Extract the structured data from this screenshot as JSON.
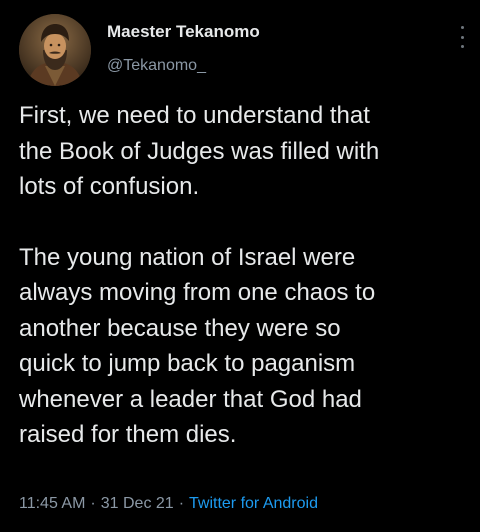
{
  "tweet": {
    "author": {
      "display_name": "Maester Tekanomo",
      "handle": "@Tekanomo_",
      "avatar_icon": "portrait-painting-avatar"
    },
    "paragraphs": [
      "First, we need to understand that\nthe Book of Judges was filled with\nlots of confusion.",
      "The young nation of Israel were\nalways moving from one chaos to\nanother because they were so\nquick to jump back to paganism\nwhenever a leader that God had\nraised for them dies."
    ],
    "time": "11:45 AM",
    "separator": "·",
    "date": "31 Dec 21",
    "source": "Twitter for Android"
  },
  "colors": {
    "background": "#000000",
    "text": "#e7e9ea",
    "secondary": "#8b98a5",
    "link": "#1d9bf0"
  }
}
